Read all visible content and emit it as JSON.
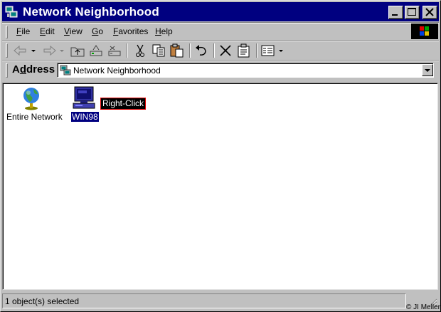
{
  "window": {
    "title": "Network Neighborhood"
  },
  "menu": {
    "items": [
      {
        "label": "File"
      },
      {
        "label": "Edit"
      },
      {
        "label": "View"
      },
      {
        "label": "Go"
      },
      {
        "label": "Favorites"
      },
      {
        "label": "Help"
      }
    ]
  },
  "toolbar": {
    "buttons": [
      {
        "icon": "back-arrow-icon"
      },
      {
        "icon": "forward-arrow-icon"
      },
      {
        "icon": "up-folder-icon"
      },
      {
        "icon": "map-drive-icon"
      },
      {
        "icon": "disconnect-drive-icon"
      },
      {
        "icon": "cut-icon"
      },
      {
        "icon": "copy-icon"
      },
      {
        "icon": "paste-icon"
      },
      {
        "icon": "undo-icon"
      },
      {
        "icon": "delete-icon"
      },
      {
        "icon": "properties-icon"
      },
      {
        "icon": "views-icon"
      }
    ]
  },
  "address": {
    "label": "Address",
    "value": "Network Neighborhood"
  },
  "content": {
    "items": [
      {
        "label": "Entire Network",
        "icon": "globe-icon",
        "selected": false
      },
      {
        "label": "WIN98",
        "icon": "computer-icon",
        "selected": true
      }
    ],
    "annotation": "Right-Click"
  },
  "status": {
    "text": "1 object(s) selected"
  },
  "watermark": {
    "text": "© JI Meller"
  },
  "colors": {
    "titlebar": "#000080",
    "face": "#c0c0c0",
    "selection": "#000080",
    "annotation_border": "#e00000"
  }
}
